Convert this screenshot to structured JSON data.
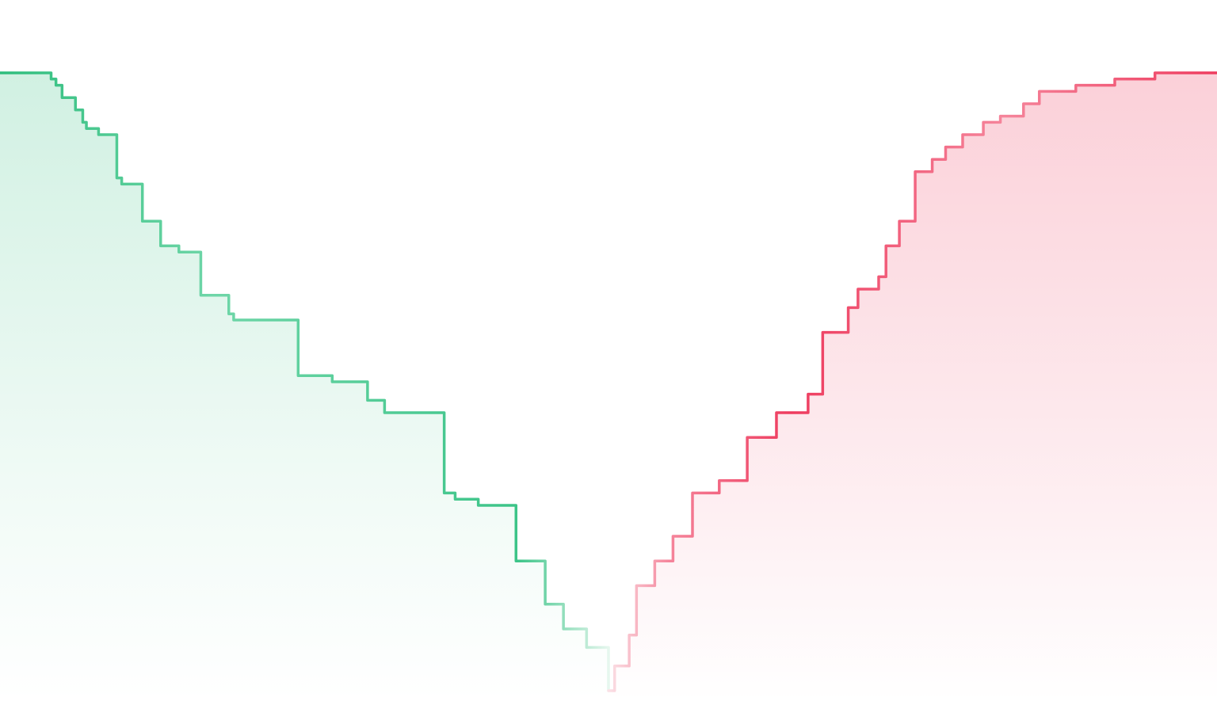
{
  "colors": {
    "bid": "#2dbd7c",
    "bid_light": "#6fd6a8",
    "ask": "#ee3b5e",
    "ask_light": "#f5859b",
    "mid_line": "#c9c9c9",
    "background": "#ffffff"
  },
  "chart_data": {
    "type": "area",
    "subtype": "depth-chart",
    "title": "",
    "xlabel": "",
    "ylabel": "",
    "xlim": [
      0,
      100
    ],
    "ylim": [
      0,
      100
    ],
    "grid": false,
    "legend": "none",
    "mid_price": 50,
    "series": [
      {
        "side": "bid",
        "x": [
          0,
          3.8,
          4.2,
          4.6,
          5.1,
          6.2,
          6.8,
          7.1,
          8.1,
          9.6,
          10.0,
          11.7,
          13.2,
          14.7,
          16.5,
          18.8,
          19.2,
          24.5,
          27.3,
          30.2,
          31.6,
          36.5,
          37.4,
          39.3,
          42.4,
          44.8,
          46.3,
          48.2,
          50
        ],
        "y": [
          100,
          100,
          99,
          98,
          96,
          94,
          92,
          91,
          90,
          83,
          82,
          76,
          72,
          71,
          64,
          61,
          60,
          51,
          50,
          47,
          45,
          32,
          31,
          30,
          21,
          14,
          10,
          7,
          0
        ]
      },
      {
        "side": "ask",
        "x": [
          50,
          50.5,
          51.7,
          52.3,
          53.8,
          55.3,
          56.9,
          59.1,
          61.4,
          63.8,
          66.4,
          67.6,
          69.7,
          70.5,
          72.2,
          72.8,
          73.9,
          75.2,
          76.6,
          77.7,
          79.1,
          80.8,
          82.2,
          84.1,
          85.4,
          88.4,
          91.6,
          94.9,
          100
        ],
        "y": [
          0,
          4,
          9,
          17,
          21,
          25,
          32,
          34,
          41,
          45,
          48,
          58,
          62,
          65,
          67,
          72,
          76,
          84,
          86,
          88,
          90,
          92,
          93,
          95,
          97,
          98,
          99,
          100,
          100
        ]
      }
    ]
  }
}
